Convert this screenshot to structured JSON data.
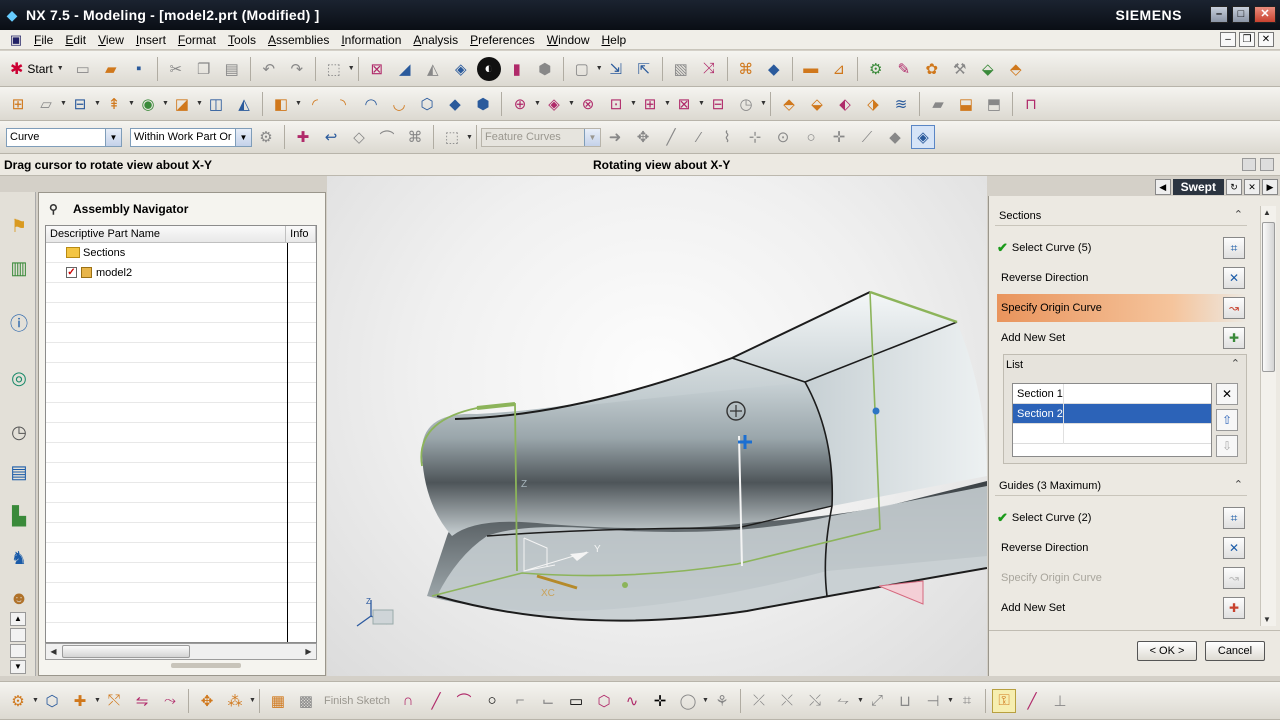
{
  "window": {
    "title": "NX 7.5 - Modeling - [model2.prt (Modified) ]",
    "brand": "SIEMENS",
    "minimize": "–",
    "maximize": "□",
    "close": "✕"
  },
  "menu": {
    "items": [
      "File",
      "Edit",
      "View",
      "Insert",
      "Format",
      "Tools",
      "Assemblies",
      "Information",
      "Analysis",
      "Preferences",
      "Window",
      "Help"
    ],
    "mdi_min": "–",
    "mdi_restore": "❐",
    "mdi_close": "✕"
  },
  "toolbar": {
    "start_label": "Start",
    "selection_filter": "Curve",
    "scope": "Within Work Part Or",
    "feature_curves": "Feature Curves"
  },
  "status": {
    "left": "Drag cursor to rotate view about X-Y",
    "right": "Rotating view about X-Y"
  },
  "navigator": {
    "title": "Assembly Navigator",
    "columns": [
      "Descriptive Part Name",
      "Info"
    ],
    "rows": [
      {
        "name": "Sections",
        "type": "folder"
      },
      {
        "name": "model2",
        "type": "part",
        "checked": true
      }
    ]
  },
  "viewport": {
    "axis_x": "XC",
    "axis_y": "Y",
    "axis_z": "Z",
    "triad_z": "Z"
  },
  "dialog": {
    "title": "Swept",
    "sections": {
      "header": "Sections",
      "select_curve": "Select Curve (5)",
      "reverse_direction": "Reverse Direction",
      "specify_origin": "Specify Origin Curve",
      "add_new_set": "Add New Set",
      "list_header": "List",
      "list_items": [
        "Section 1",
        "Section 2"
      ]
    },
    "guides": {
      "header": "Guides (3 Maximum)",
      "select_curve": "Select Curve (2)",
      "reverse_direction": "Reverse Direction",
      "specify_origin": "Specify Origin Curve",
      "add_new_set": "Add New Set"
    },
    "ok": "< OK >",
    "cancel": "Cancel"
  },
  "bottom_toolbar": {
    "finish_sketch": "Finish Sketch"
  },
  "colors": {
    "accent_blue": "#2c63b8",
    "active_orange": "#e9945c",
    "title_bar": "#0a0e15",
    "model_edge": "#8cb45a"
  }
}
